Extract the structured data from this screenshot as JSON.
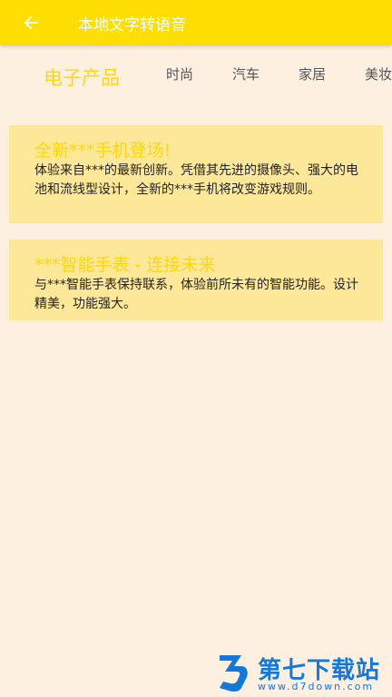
{
  "app_bar": {
    "title": "本地文字转语音",
    "back_icon": "arrow-left-icon",
    "bg_color": "#ffde03"
  },
  "tabs": [
    {
      "label": "电子产品",
      "active": true
    },
    {
      "label": "时尚",
      "active": false
    },
    {
      "label": "汽车",
      "active": false
    },
    {
      "label": "家居",
      "active": false
    },
    {
      "label": "美妆",
      "active": false
    }
  ],
  "cards": [
    {
      "title": "全新***手机登场!",
      "body": "体验来自***的最新创新。凭借其先进的摄像头、强大的电池和流线型设计，全新的***手机将改变游戏规则。"
    },
    {
      "title": "***智能手表 - 连接未来",
      "body": "与***智能手表保持联系，体验前所未有的智能功能。设计精美，功能强大。"
    }
  ],
  "watermark": {
    "name": "第七下载站",
    "url": "www.d7down.com"
  },
  "colors": {
    "accent": "#ffd70a",
    "background": "#fdf0e1",
    "card": "#fde89a"
  }
}
